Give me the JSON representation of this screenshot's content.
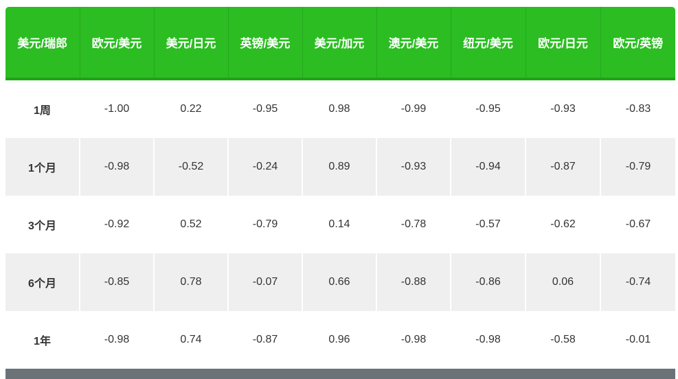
{
  "table": {
    "headers": [
      "美元/瑞郎",
      "欧元/美元",
      "美元/日元",
      "英镑/美元",
      "美元/加元",
      "澳元/美元",
      "纽元/美元",
      "欧元/日元",
      "欧元/英镑"
    ],
    "rows": [
      {
        "period": "1周",
        "values": [
          "-1.00",
          "0.22",
          "-0.95",
          "0.98",
          "-0.99",
          "-0.95",
          "-0.93",
          "-0.83"
        ]
      },
      {
        "period": "1个月",
        "values": [
          "-0.98",
          "-0.52",
          "-0.24",
          "0.89",
          "-0.93",
          "-0.94",
          "-0.87",
          "-0.79"
        ]
      },
      {
        "period": "3个月",
        "values": [
          "-0.92",
          "0.52",
          "-0.79",
          "0.14",
          "-0.78",
          "-0.57",
          "-0.62",
          "-0.67"
        ]
      },
      {
        "period": "6个月",
        "values": [
          "-0.85",
          "0.78",
          "-0.07",
          "0.66",
          "-0.88",
          "-0.86",
          "0.06",
          "-0.74"
        ]
      },
      {
        "period": "1年",
        "values": [
          "-0.98",
          "0.74",
          "-0.87",
          "0.96",
          "-0.98",
          "-0.98",
          "-0.58",
          "-0.01"
        ]
      }
    ]
  },
  "colors": {
    "header_bg": "#2bbd22",
    "header_text": "#ffffff",
    "stripe": "#efefef",
    "footer_bar": "#6b7278"
  }
}
